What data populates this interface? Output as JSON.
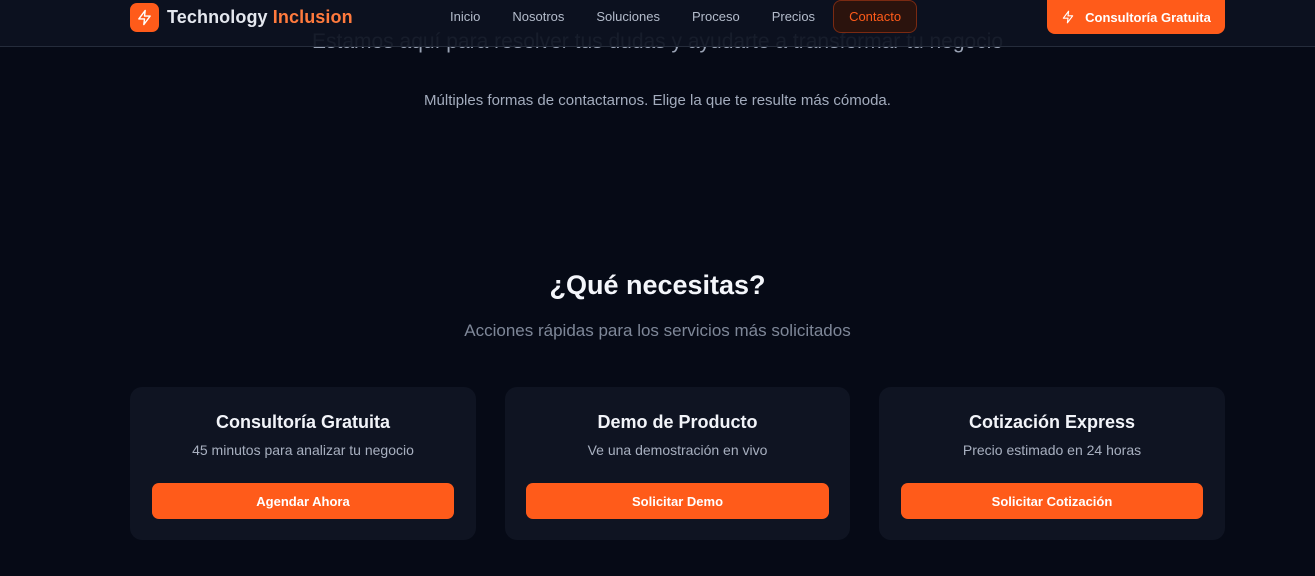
{
  "header": {
    "brand_part1": "Technology",
    "brand_part2": "Inclusion",
    "nav": [
      "Inicio",
      "Nosotros",
      "Soluciones",
      "Proceso",
      "Precios",
      "Contacto"
    ],
    "active_nav": "Contacto",
    "cta_label": "Consultoría Gratuita"
  },
  "hero": {
    "subtitle": "Estamos aquí para resolver tus dudas y ayudarte a transformar tu negocio",
    "description": "Múltiples formas de contactarnos. Elige la que te resulte más cómoda."
  },
  "quick_actions": {
    "title": "¿Qué necesitas?",
    "subtitle": "Acciones rápidas para los servicios más solicitados",
    "cards": [
      {
        "title": "Consultoría Gratuita",
        "description": "45 minutos para analizar tu negocio",
        "button": "Agendar Ahora"
      },
      {
        "title": "Demo de Producto",
        "description": "Ve una demostración en vivo",
        "button": "Solicitar Demo"
      },
      {
        "title": "Cotización Express",
        "description": "Precio estimado en 24 horas",
        "button": "Solicitar Cotización"
      }
    ]
  },
  "icons": {
    "logo": "lightning-bolt-icon",
    "cta": "lightning-bolt-icon"
  },
  "colors": {
    "accent": "#ff5b1a",
    "background": "#060a16",
    "card": "#0f1422"
  }
}
